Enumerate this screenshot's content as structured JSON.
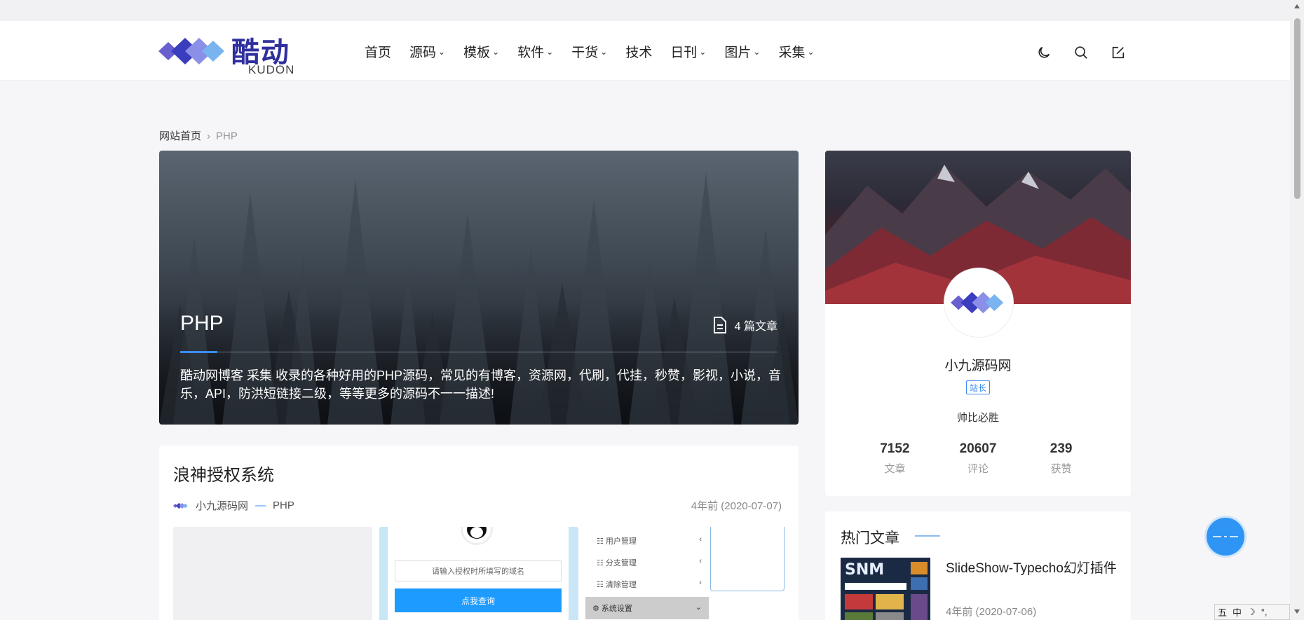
{
  "brand": {
    "name": "酷动",
    "sub": "KUDON"
  },
  "nav": [
    {
      "label": "首页",
      "dropdown": false
    },
    {
      "label": "源码",
      "dropdown": true
    },
    {
      "label": "模板",
      "dropdown": true
    },
    {
      "label": "软件",
      "dropdown": true
    },
    {
      "label": "干货",
      "dropdown": true
    },
    {
      "label": "技术",
      "dropdown": false
    },
    {
      "label": "日刊",
      "dropdown": true
    },
    {
      "label": "图片",
      "dropdown": true
    },
    {
      "label": "采集",
      "dropdown": true
    }
  ],
  "header_icons": [
    "moon-icon",
    "search-icon",
    "edit-icon"
  ],
  "breadcrumb": {
    "home": "网站首页",
    "separator": "›",
    "current": "PHP"
  },
  "category": {
    "title": "PHP",
    "count": "4 篇文章",
    "description": "酷动网博客 采集 收录的各种好用的PHP源码，常见的有博客，资源网，代刷，代挂，秒赞，影视，小说，音乐，API，防洪短链接二级，等等更多的源码不一一描述!"
  },
  "post": {
    "title": "浪神授权系统",
    "author": "小九源码网",
    "dash": "—",
    "category": "PHP",
    "date": "4年前 (2020-07-07)",
    "thumb2": {
      "input_placeholder": "请输入授权时所填写的域名",
      "button": "点我查询"
    },
    "thumb3": {
      "menu": [
        {
          "label": "用户管理"
        },
        {
          "label": "分支管理"
        },
        {
          "label": "清除管理"
        },
        {
          "label": "系统设置"
        }
      ]
    }
  },
  "profile": {
    "name": "小九源码网",
    "badge": "站长",
    "motto": "帅比必胜",
    "stats": [
      {
        "num": "7152",
        "label": "文章"
      },
      {
        "num": "20607",
        "label": "评论"
      },
      {
        "num": "239",
        "label": "获赞"
      }
    ]
  },
  "hot": {
    "title": "热门文章",
    "items": [
      {
        "title": "SlideShow-Typecho幻灯插件",
        "date": "4年前 (2020-07-06)"
      }
    ]
  },
  "ime": {
    "a": "五",
    "b": "中",
    "c": "☽",
    "d": "°,"
  },
  "colors": {
    "accent": "#3b8cf2",
    "brand": "#2f2f9e",
    "button": "#1e9bff"
  }
}
